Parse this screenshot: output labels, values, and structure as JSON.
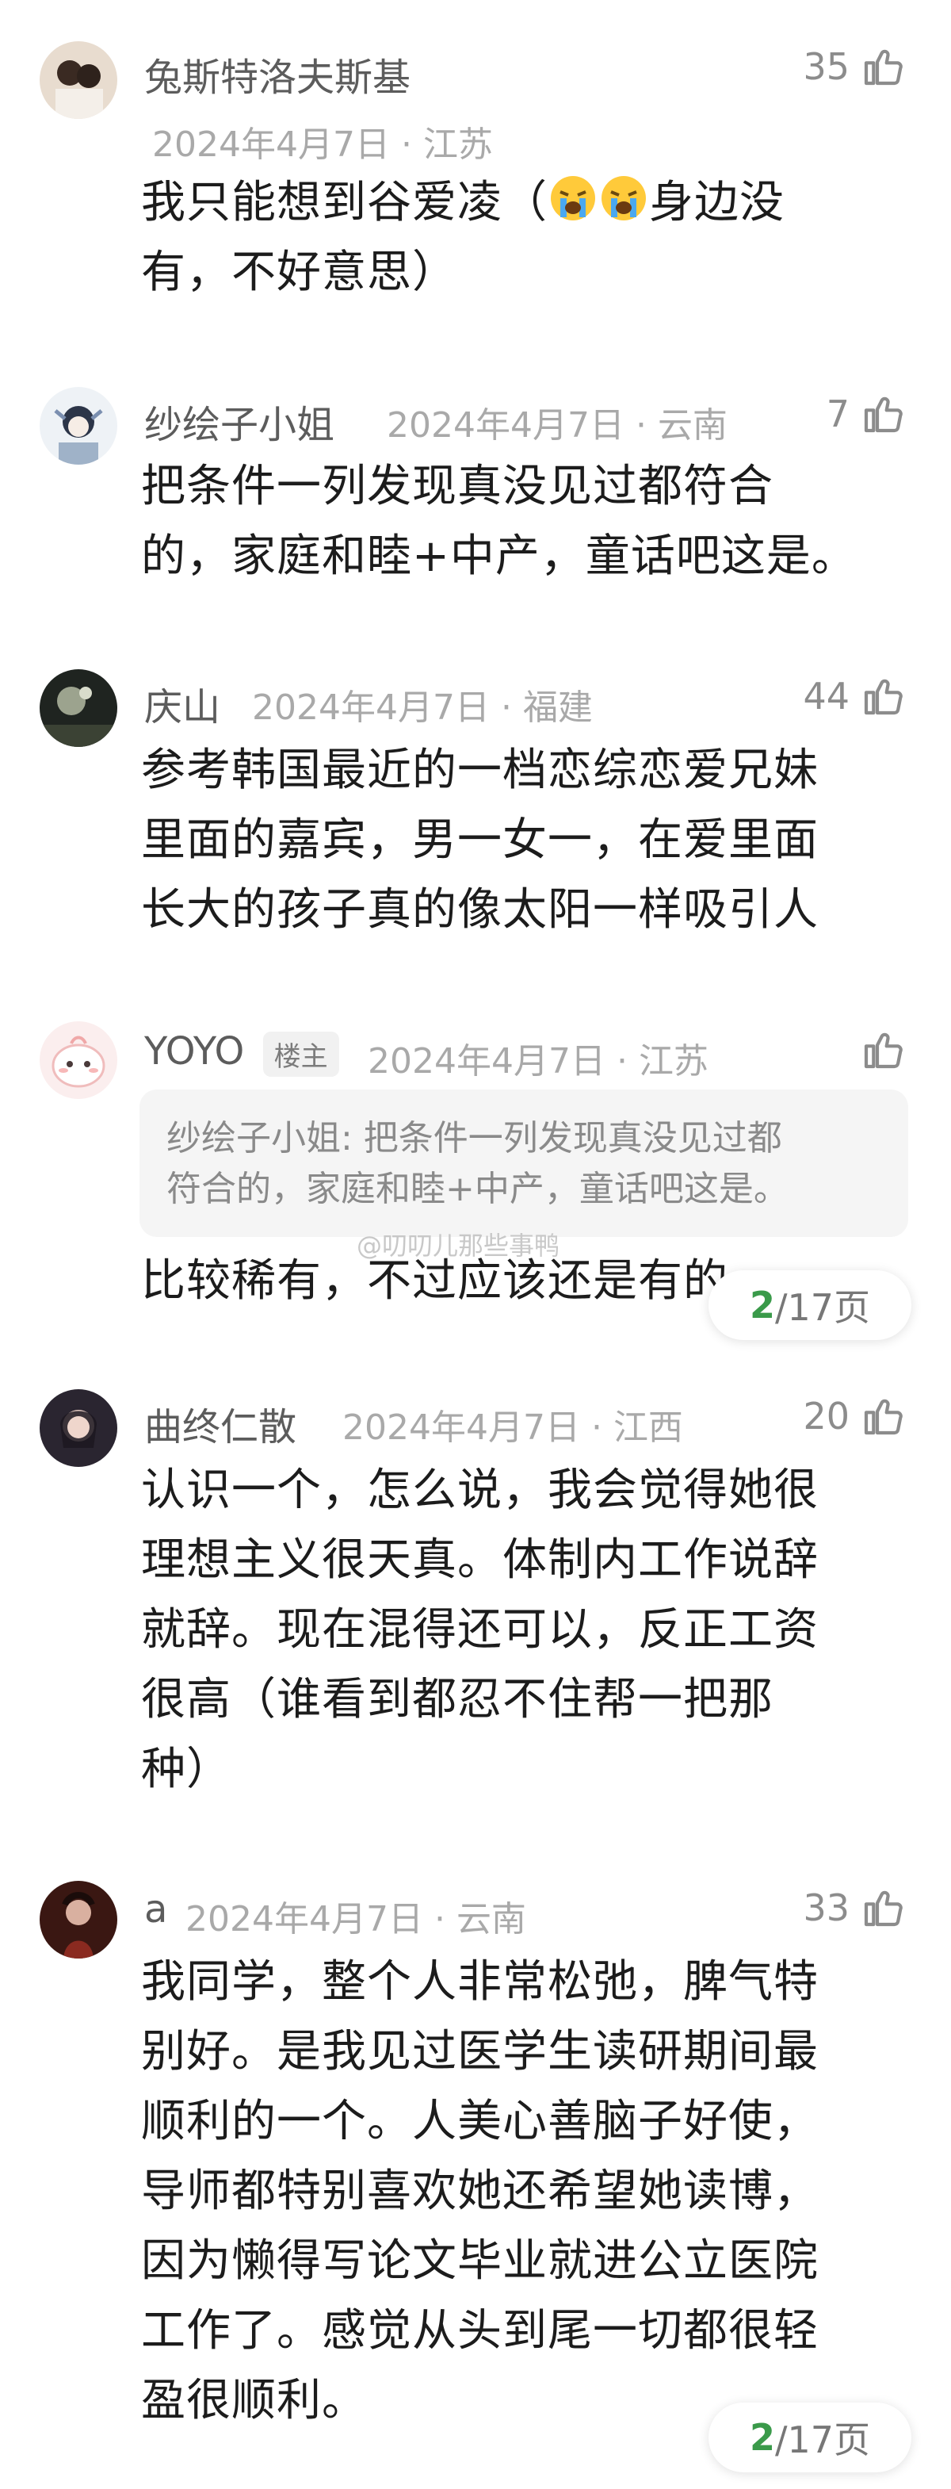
{
  "comments": [
    {
      "name": "兔斯特洛夫斯基",
      "date": "2024年4月7日",
      "region": "江苏",
      "likes": "35",
      "text_before_emoji": "我只能想到谷爱凌（",
      "emojis": [
        "crying-face-icon",
        "crying-face-icon"
      ],
      "text_after_emoji": "身边没",
      "lines_rest": [
        "有，不好意思）"
      ],
      "avatar_color": "#d8c6b6"
    },
    {
      "name": "纱绘子小姐",
      "date": "2024年4月7日",
      "region": "云南",
      "likes": "7",
      "lines": [
        "把条件一列发现真没见过都符合",
        "的，家庭和睦+中产，童话吧这是。"
      ],
      "avatar_color": "#9fb2c8"
    },
    {
      "name": "庆山",
      "date": "2024年4月7日",
      "region": "福建",
      "likes": "44",
      "lines": [
        "参考韩国最近的一档恋综恋爱兄妹",
        "里面的嘉宾，男一女一，在爱里面",
        "长大的孩子真的像太阳一样吸引人"
      ],
      "avatar_color": "#3a3f3a"
    },
    {
      "name": "YOYO",
      "badge": "楼主",
      "date": "2024年4月7日",
      "region": "江苏",
      "likes": "",
      "quote_lines": [
        "纱绘子小姐: 把条件一列发现真没见过都",
        "符合的，家庭和睦+中产，童话吧这是。"
      ],
      "lines": [
        "比较稀有，不过应该还是有的"
      ],
      "avatar_color": "#f6dcdc"
    },
    {
      "name": "曲终仁散",
      "date": "2024年4月7日",
      "region": "江西",
      "likes": "20",
      "lines": [
        "认识一个，怎么说，我会觉得她很",
        "理想主义很天真。体制内工作说辞",
        "就辞。现在混得还可以，反正工资",
        "很高（谁看到都忍不住帮一把那",
        "种）"
      ],
      "avatar_color": "#2e2a33"
    },
    {
      "name": "a",
      "date": "2024年4月7日",
      "region": "云南",
      "likes": "33",
      "lines": [
        "我同学，整个人非常松弛，脾气特",
        "别好。是我见过医学生读研期间最",
        "顺利的一个。人美心善脑子好使，",
        "导师都特别喜欢她还希望她读博，",
        "因为懒得写论文毕业就进公立医院",
        "工作了。感觉从头到尾一切都很轻",
        "盈很顺利。"
      ],
      "avatar_color": "#5b2a22"
    }
  ],
  "separator": " · ",
  "pagination": {
    "current": "2",
    "total": "/17页"
  },
  "watermark": "@叨叨儿那些事鸭"
}
